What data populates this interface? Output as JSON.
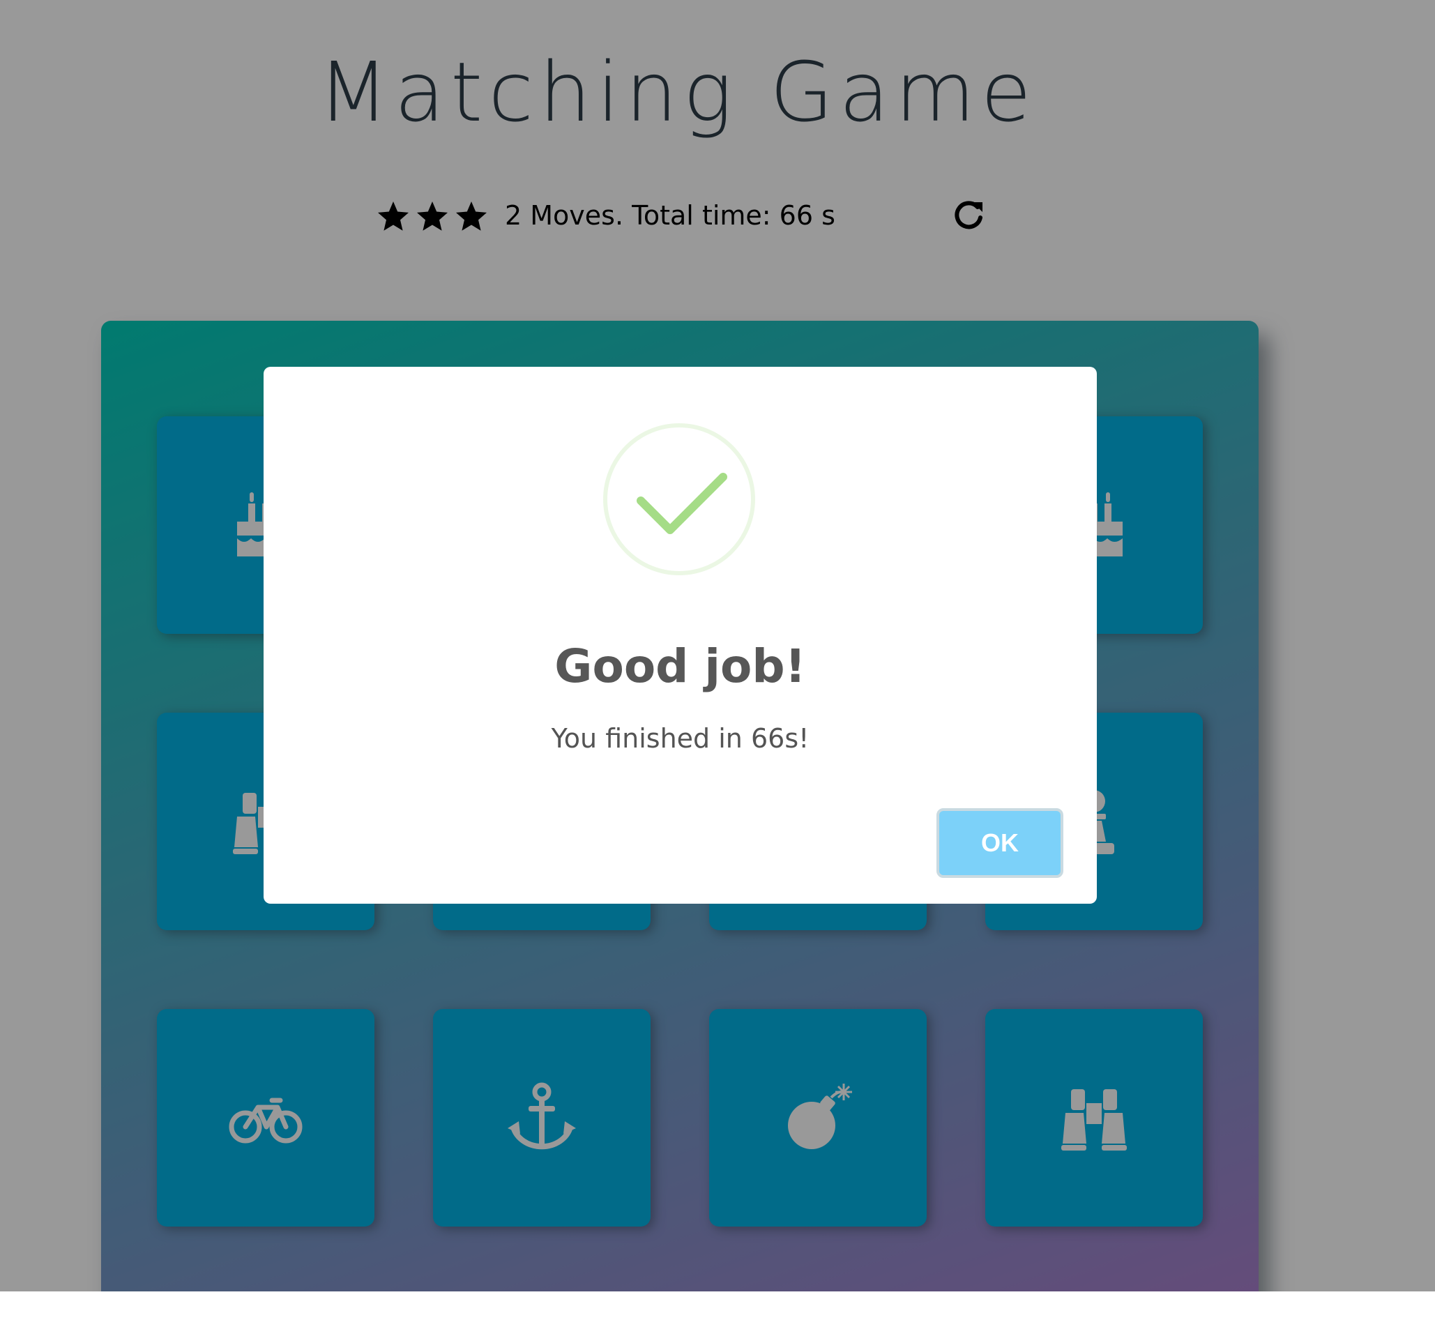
{
  "header": {
    "title": "Matching Game"
  },
  "score_panel": {
    "stars": [
      "star-icon",
      "star-icon",
      "star-icon"
    ],
    "status_text": "2 Moves. Total time: 66 s",
    "restart_icon": "repeat-icon"
  },
  "deck": {
    "cards": [
      {
        "icon": "birthday-cake-icon",
        "state": "match"
      },
      {
        "icon": "hidden",
        "state": "match"
      },
      {
        "icon": "hidden",
        "state": "match"
      },
      {
        "icon": "birthday-cake-icon",
        "state": "match"
      },
      {
        "icon": "binoculars-icon",
        "state": "match"
      },
      {
        "icon": "hidden",
        "state": "match"
      },
      {
        "icon": "hidden",
        "state": "match"
      },
      {
        "icon": "chess-pawn-icon",
        "state": "match"
      },
      {
        "icon": "bicycle-icon",
        "state": "match"
      },
      {
        "icon": "anchor-icon",
        "state": "match"
      },
      {
        "icon": "bomb-icon",
        "state": "match"
      },
      {
        "icon": "binoculars-icon",
        "state": "match"
      }
    ]
  },
  "modal": {
    "icon": "success-check-icon",
    "title": "Good job!",
    "text": "You finished in 66s!",
    "ok_label": "OK"
  },
  "colors": {
    "page_background": "#ffffff",
    "overlay": "rgba(0,0,0,0.4)",
    "card_matched": "#02b3e4",
    "deck_gradient_start": "#02ccba",
    "deck_gradient_end": "#aa7ecd",
    "ok_button": "#7cd1f9",
    "success_check": "#a5dc86"
  }
}
